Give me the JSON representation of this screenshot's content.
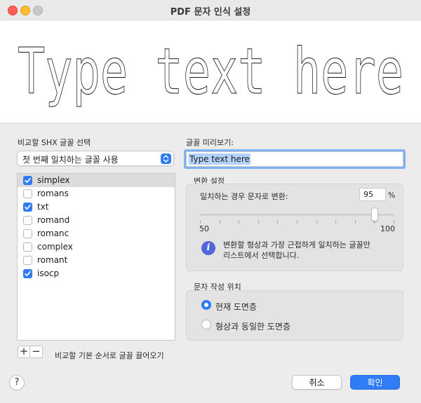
{
  "window": {
    "title": "PDF 문자 인식 설정"
  },
  "preview": {
    "sample_text": "Type text here"
  },
  "shx_section": {
    "label": "비교할 SHX 글꼴 선택",
    "popup_value": "첫 번째 일치하는 글꼴 사용",
    "fonts": [
      {
        "name": "simplex",
        "checked": true,
        "selected": true
      },
      {
        "name": "romans",
        "checked": false,
        "selected": false
      },
      {
        "name": "txt",
        "checked": true,
        "selected": false
      },
      {
        "name": "romand",
        "checked": false,
        "selected": false
      },
      {
        "name": "romanc",
        "checked": false,
        "selected": false
      },
      {
        "name": "complex",
        "checked": false,
        "selected": false
      },
      {
        "name": "romant",
        "checked": false,
        "selected": false
      },
      {
        "name": "isocp",
        "checked": true,
        "selected": false
      }
    ],
    "add_label": "+",
    "remove_label": "−",
    "reset_order_label": "비교할 기본 순서로 글꼴 끌어오기"
  },
  "font_preview": {
    "label": "글꼴 미리보기:",
    "value": "Type text here"
  },
  "conversion": {
    "group_label": "변환 설정",
    "convert_label": "일치하는 경우 문자로 변환:",
    "percent_value": "95",
    "percent_unit": "%",
    "slider_min": "50",
    "slider_max": "100",
    "slider_value": 95,
    "info_text_line1": "변환할 형상과 가장 근접하게 일치하는 글꼴만",
    "info_text_line2": "리스트에서 선택합니다."
  },
  "placement": {
    "group_label": "문자 작성 위치",
    "options": [
      {
        "label": "현재 도면층",
        "selected": true
      },
      {
        "label": "형상과 동일한 도면층",
        "selected": false
      }
    ]
  },
  "footer": {
    "help_label": "?",
    "cancel_label": "취소",
    "ok_label": "확인"
  },
  "colors": {
    "accent": "#2f7cf6",
    "info": "#5166d8"
  }
}
